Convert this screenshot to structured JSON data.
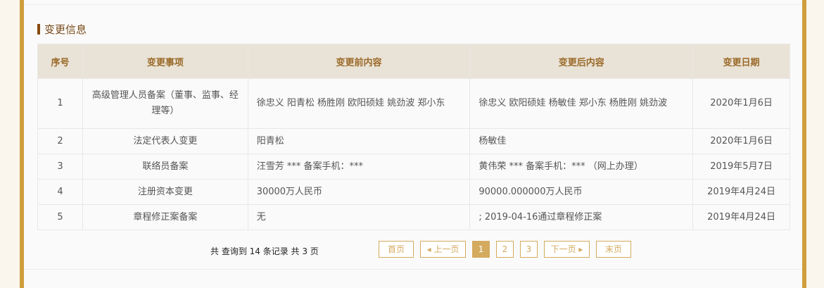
{
  "section_title": "变更信息",
  "table": {
    "headers": [
      "序号",
      "变更事项",
      "变更前内容",
      "变更后内容",
      "变更日期"
    ],
    "rows": [
      [
        "1",
        "高级管理人员备案（董事、监事、经理等）",
        "徐忠义 阳青松 杨胜刚 欧阳硕娃 姚劲波 郑小东",
        "徐忠义 欧阳硕娃 杨敏佳 郑小东 杨胜刚 姚劲波",
        "2020年1月6日"
      ],
      [
        "2",
        "法定代表人变更",
        "阳青松",
        "杨敏佳",
        "2020年1月6日"
      ],
      [
        "3",
        "联络员备案",
        "汪雪芳 *** 备案手机：***",
        "黄伟荣 *** 备案手机：*** （网上办理）",
        "2019年5月7日"
      ],
      [
        "4",
        "注册资本变更",
        "30000万人民币",
        "90000.000000万人民币",
        "2019年4月24日"
      ],
      [
        "5",
        "章程修正案备案",
        "无",
        "; 2019-04-16通过章程修正案",
        "2019年4月24日"
      ]
    ]
  },
  "pagination": {
    "summary": "共 查询到 14 条记录 共 3 页",
    "first": "首页",
    "prev": "◂ 上一页",
    "pages": [
      "1",
      "2",
      "3"
    ],
    "next": "下一页 ▸",
    "last": "末页",
    "current": "1"
  }
}
